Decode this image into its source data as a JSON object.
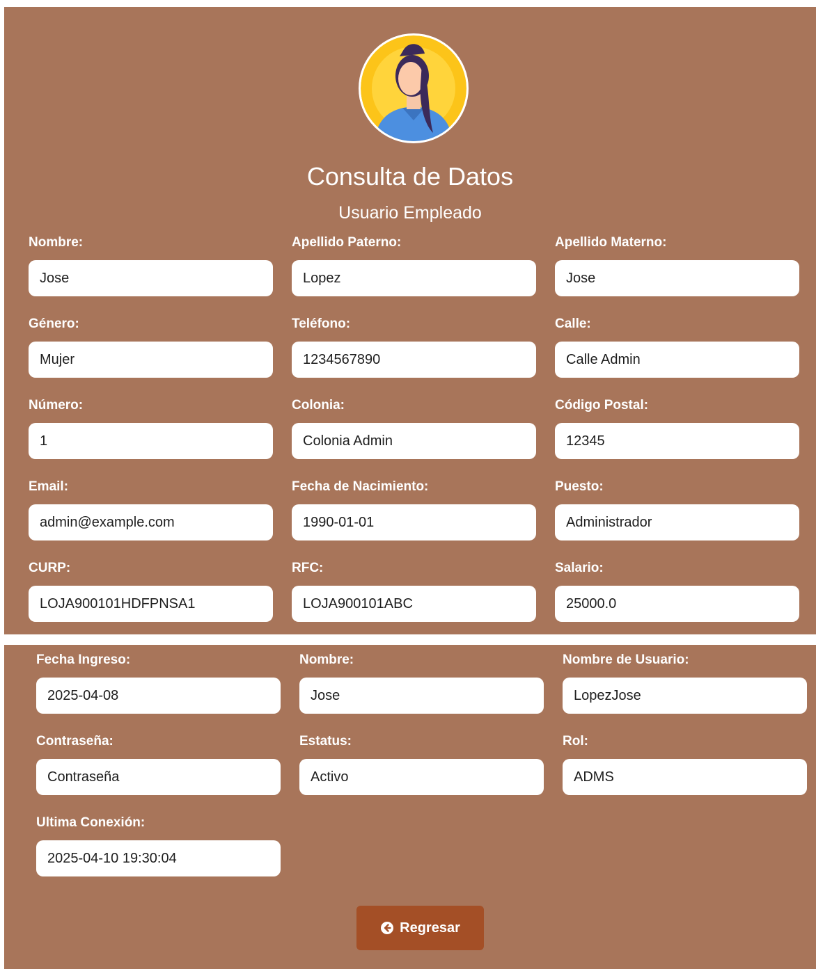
{
  "header": {
    "avatar_icon": "woman-avatar-icon",
    "title": "Consulta de Datos",
    "subtitle": "Usuario Empleado"
  },
  "employee_fields": [
    {
      "label": "Nombre:",
      "value": "Jose"
    },
    {
      "label": "Apellido Paterno:",
      "value": "Lopez"
    },
    {
      "label": "Apellido Materno:",
      "value": "Jose"
    },
    {
      "label": "Género:",
      "value": "Mujer"
    },
    {
      "label": "Teléfono:",
      "value": "1234567890"
    },
    {
      "label": "Calle:",
      "value": "Calle Admin"
    },
    {
      "label": "Número:",
      "value": "1"
    },
    {
      "label": "Colonia:",
      "value": "Colonia Admin"
    },
    {
      "label": "Código Postal:",
      "value": "12345"
    },
    {
      "label": "Email:",
      "value": "admin@example.com"
    },
    {
      "label": "Fecha de Nacimiento:",
      "value": "1990-01-01"
    },
    {
      "label": "Puesto:",
      "value": "Administrador"
    },
    {
      "label": "CURP:",
      "value": "LOJA900101HDFPNSA1"
    },
    {
      "label": "RFC:",
      "value": "LOJA900101ABC"
    },
    {
      "label": "Salario:",
      "value": "25000.0"
    }
  ],
  "user_fields": [
    {
      "label": "Fecha Ingreso:",
      "value": "2025-04-08"
    },
    {
      "label": "Nombre:",
      "value": "Jose"
    },
    {
      "label": "Nombre de Usuario:",
      "value": "LopezJose"
    },
    {
      "label": "Contraseña:",
      "value": "Contraseña"
    },
    {
      "label": "Estatus:",
      "value": "Activo"
    },
    {
      "label": "Rol:",
      "value": "ADMS"
    },
    {
      "label": "Ultima Conexión:",
      "value": "2025-04-10 19:30:04"
    }
  ],
  "actions": {
    "back_label": "Regresar",
    "back_icon": "arrow-circle-left-icon"
  },
  "colors": {
    "panel_background": "#a8755a",
    "button_background": "#a44f26",
    "field_background": "#ffffff",
    "text_on_panel": "#ffffff"
  }
}
